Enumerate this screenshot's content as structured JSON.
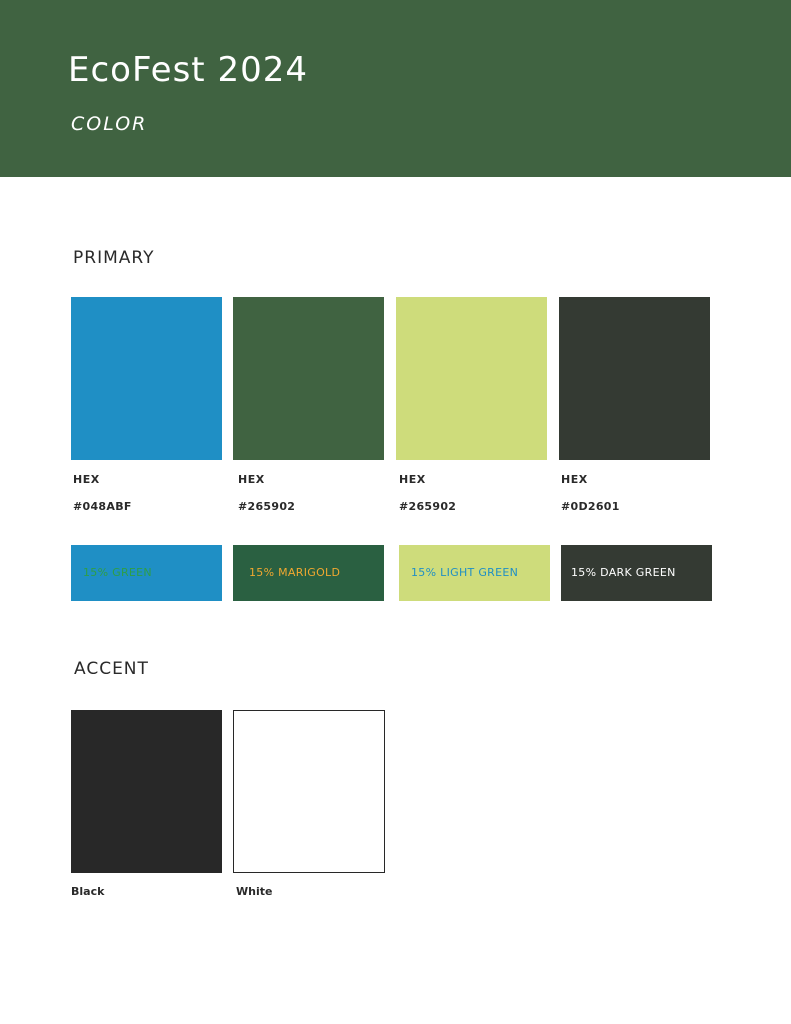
{
  "header": {
    "title": "EcoFest 2024",
    "subtitle": "COLOR",
    "background": "#406341"
  },
  "primary": {
    "heading": "PRIMARY",
    "swatches": [
      {
        "hex_label": "HEX",
        "hex_value": "#048ABF",
        "color": "#1F8FC5"
      },
      {
        "hex_label": "HEX",
        "hex_value": "#265902",
        "color": "#406341"
      },
      {
        "hex_label": "HEX",
        "hex_value": "#265902",
        "color": "#CEDC7B"
      },
      {
        "hex_label": "HEX",
        "hex_value": "#0D2601",
        "color": "#343A33"
      }
    ],
    "tints": [
      {
        "label": "15% GREEN",
        "background": "#1F8FC5",
        "text_color": "#2E9E46"
      },
      {
        "label": "15% MARIGOLD",
        "background": "#2A6041",
        "text_color": "#F0A830"
      },
      {
        "label": "15% LIGHT GREEN",
        "background": "#CEDC7B",
        "text_color": "#1F8FC5"
      },
      {
        "label": "15% DARK GREEN",
        "background": "#343A33",
        "text_color": "#FFFFFF"
      }
    ]
  },
  "accent": {
    "heading": "ACCENT",
    "swatches": [
      {
        "label": "Black",
        "color": "#282828"
      },
      {
        "label": "White",
        "color": "#FFFFFF",
        "border": "#282828"
      }
    ]
  }
}
